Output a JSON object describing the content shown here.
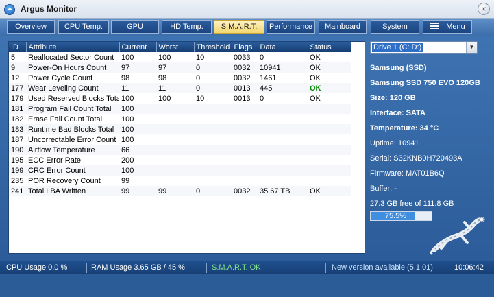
{
  "app": {
    "title": "Argus Monitor",
    "close_glyph": "×"
  },
  "tabs": [
    {
      "label": "Overview"
    },
    {
      "label": "CPU Temp."
    },
    {
      "label": "GPU"
    },
    {
      "label": "HD Temp."
    },
    {
      "label": "S.M.A.R.T.",
      "active": true
    },
    {
      "label": "Performance"
    },
    {
      "label": "Mainboard"
    },
    {
      "label": "System"
    },
    {
      "label": "Menu",
      "icon": "hamburger-icon"
    }
  ],
  "smart_table": {
    "columns": [
      "ID",
      "Attribute",
      "Current",
      "Worst",
      "Threshold",
      "Flags",
      "Data",
      "Status"
    ],
    "rows": [
      [
        "5",
        "Reallocated Sector Count",
        "100",
        "100",
        "10",
        "0033",
        "0",
        "OK"
      ],
      [
        "9",
        "Power-On Hours Count",
        "97",
        "97",
        "0",
        "0032",
        "10941",
        "OK"
      ],
      [
        "12",
        "Power Cycle Count",
        "98",
        "98",
        "0",
        "0032",
        "1461",
        "OK"
      ],
      [
        "177",
        "Wear Leveling Count",
        "11",
        "11",
        "0",
        "0013",
        "445",
        "OK"
      ],
      [
        "179",
        "Used Reserved Blocks Total",
        "100",
        "100",
        "10",
        "0013",
        "0",
        "OK"
      ],
      [
        "181",
        "Program Fail Count Total",
        "100",
        "",
        "",
        "",
        "",
        ""
      ],
      [
        "182",
        "Erase Fail Count Total",
        "100",
        "",
        "",
        "",
        "",
        ""
      ],
      [
        "183",
        "Runtime Bad Blocks Total",
        "100",
        "",
        "",
        "",
        "",
        ""
      ],
      [
        "187",
        "Uncorrectable Error Count",
        "100",
        "",
        "",
        "",
        "",
        ""
      ],
      [
        "190",
        "Airflow Temperature",
        "66",
        "",
        "",
        "",
        "",
        ""
      ],
      [
        "195",
        "ECC Error Rate",
        "200",
        "",
        "",
        "",
        "",
        ""
      ],
      [
        "199",
        "CRC Error Count",
        "100",
        "",
        "",
        "",
        "",
        ""
      ],
      [
        "235",
        "POR Recovery Count",
        "99",
        "",
        "",
        "",
        "",
        ""
      ],
      [
        "241",
        "Total LBA Written",
        "99",
        "99",
        "0",
        "0032",
        "35.67 TB",
        "OK"
      ]
    ],
    "highlight_status_row": 3
  },
  "drive": {
    "selected": "Drive 1 (C: D:)",
    "brand": "Samsung (SSD)",
    "model": "Samsung SSD 750 EVO 120GB",
    "size": "Size: 120 GB",
    "interface": "Interface: SATA",
    "temperature": "Temperature: 34 °C",
    "uptime": "Uptime: 10941",
    "serial": "Serial: S32KNB0H720493A",
    "firmware": "Firmware: MAT01B6Q",
    "buffer": "Buffer: -",
    "free": "27.3 GB free of 111.8 GB",
    "usage_percent_label": "75.5%",
    "usage_fraction": 0.755
  },
  "statusbar": {
    "cpu": "CPU Usage 0.0 %",
    "ram": "RAM Usage 3.65 GB / 45 %",
    "smart": "S.M.A.R.T. OK",
    "update": "New version available (5.1.01)",
    "clock": "10:06:42"
  },
  "colors": {
    "accent": "#2f6fc8",
    "ok_green": "#008a00",
    "tab_active": "#f2d66e",
    "panel_blue": "#2c5c99"
  },
  "icons": {
    "app": "argus-logo-icon",
    "close": "close-icon",
    "dropdown": "chevron-down-icon",
    "mascot": "gecko-logo-icon"
  }
}
